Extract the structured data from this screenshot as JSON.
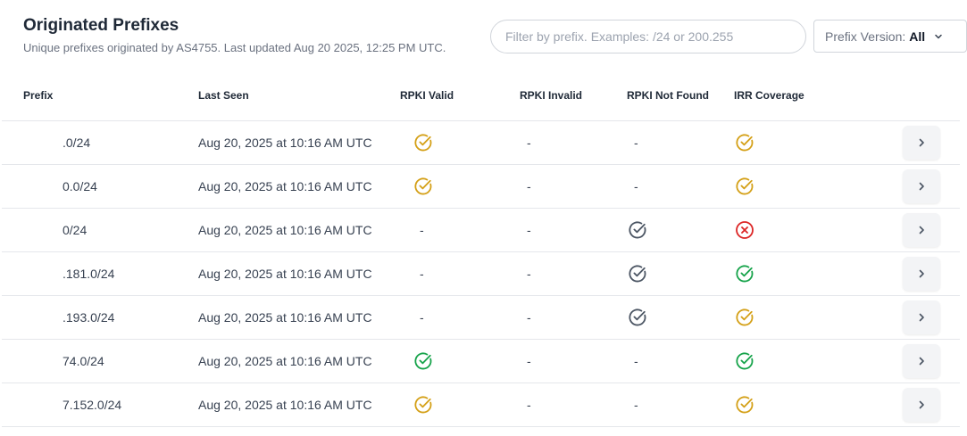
{
  "header": {
    "title": "Originated Prefixes",
    "subtitle": "Unique prefixes originated by AS4755. Last updated Aug 20 2025, 12:25 PM UTC."
  },
  "filter": {
    "placeholder": "Filter by prefix. Examples: /24 or 200.255"
  },
  "version_select": {
    "label": "Prefix Version:",
    "value": "All"
  },
  "table": {
    "columns": [
      "Prefix",
      "Last Seen",
      "RPKI Valid",
      "RPKI Invalid",
      "RPKI Not Found",
      "IRR Coverage"
    ],
    "rows": [
      {
        "prefix": ".0/24",
        "last_seen": "Aug 20, 2025 at 10:16 AM UTC",
        "rpki_valid": "check-orange",
        "rpki_invalid": "-",
        "rpki_not_found": "-",
        "irr": "check-orange"
      },
      {
        "prefix": "0.0/24",
        "last_seen": "Aug 20, 2025 at 10:16 AM UTC",
        "rpki_valid": "check-orange",
        "rpki_invalid": "-",
        "rpki_not_found": "-",
        "irr": "check-orange"
      },
      {
        "prefix": "0/24",
        "last_seen": "Aug 20, 2025 at 10:16 AM UTC",
        "rpki_valid": "-",
        "rpki_invalid": "-",
        "rpki_not_found": "check-gray",
        "irr": "x-red"
      },
      {
        "prefix": ".181.0/24",
        "last_seen": "Aug 20, 2025 at 10:16 AM UTC",
        "rpki_valid": "-",
        "rpki_invalid": "-",
        "rpki_not_found": "check-gray",
        "irr": "check-green"
      },
      {
        "prefix": ".193.0/24",
        "last_seen": "Aug 20, 2025 at 10:16 AM UTC",
        "rpki_valid": "-",
        "rpki_invalid": "-",
        "rpki_not_found": "check-gray",
        "irr": "check-orange"
      },
      {
        "prefix": "74.0/24",
        "last_seen": "Aug 20, 2025 at 10:16 AM UTC",
        "rpki_valid": "check-green",
        "rpki_invalid": "-",
        "rpki_not_found": "-",
        "irr": "check-green"
      },
      {
        "prefix": "7.152.0/24",
        "last_seen": "Aug 20, 2025 at 10:16 AM UTC",
        "rpki_valid": "check-orange",
        "rpki_invalid": "-",
        "rpki_not_found": "-",
        "irr": "check-orange"
      }
    ]
  },
  "colors": {
    "orange": "#d4a017",
    "green": "#16a34a",
    "gray": "#4b5563",
    "red": "#dc2626"
  }
}
